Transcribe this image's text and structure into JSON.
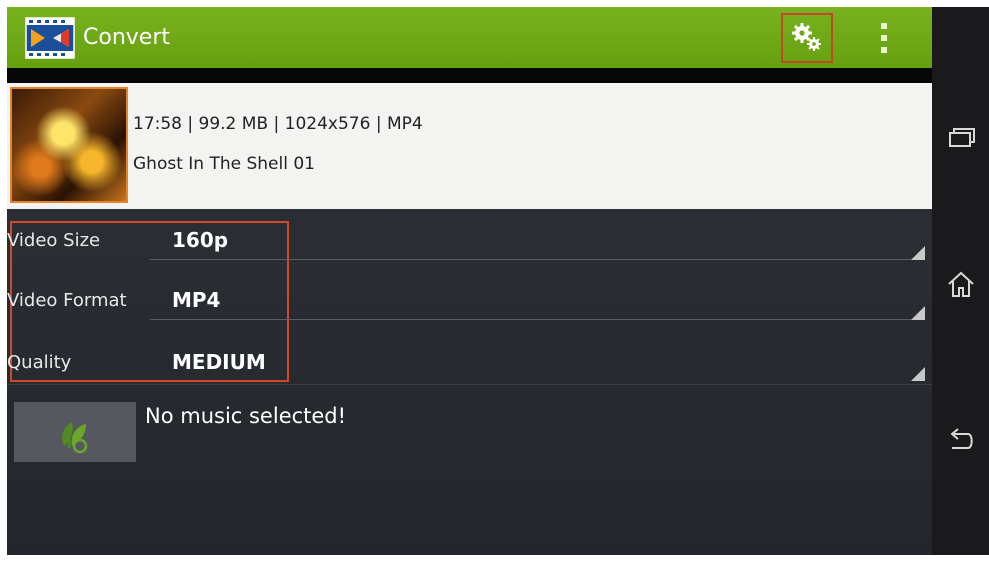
{
  "actionbar": {
    "title": "Convert",
    "logo_icon": "clapperboard-logo-icon",
    "settings_icon": "gears-icon",
    "overflow_icon": "vertical-dots-icon"
  },
  "video": {
    "meta": "17:58 | 99.2 MB | 1024x576 | MP4",
    "name": "Ghost In The Shell 01"
  },
  "settings": {
    "video_size": {
      "label": "Video Size",
      "value": "160p"
    },
    "video_format": {
      "label": "Video Format",
      "value": "MP4"
    },
    "quality": {
      "label": "Quality",
      "value": "MEDIUM"
    }
  },
  "music": {
    "status": "No music selected!",
    "icon": "music-leaf-icon"
  },
  "navbar": {
    "recent_icon": "recent-apps-icon",
    "home_icon": "home-icon",
    "back_icon": "back-icon"
  },
  "colors": {
    "actionbar": "#6faa16",
    "highlight": "#d2492a",
    "screen_bg": "#2b2f34"
  }
}
